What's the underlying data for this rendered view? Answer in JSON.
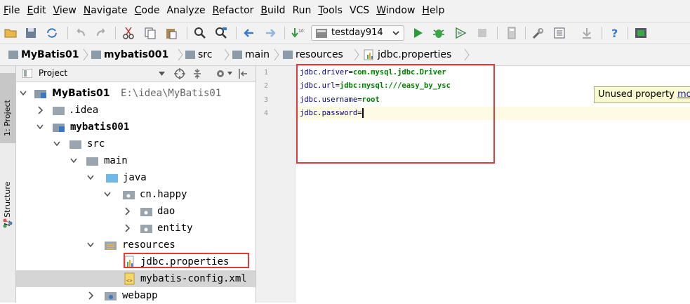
{
  "menu": [
    {
      "mnemonic": "F",
      "rest": "ile"
    },
    {
      "mnemonic": "E",
      "rest": "dit"
    },
    {
      "mnemonic": "V",
      "rest": "iew"
    },
    {
      "mnemonic": "N",
      "rest": "avigate"
    },
    {
      "mnemonic": "C",
      "rest": "ode"
    },
    {
      "mnemonic": "",
      "rest": "Analyze"
    },
    {
      "mnemonic": "R",
      "rest": "efactor"
    },
    {
      "mnemonic": "B",
      "rest": "uild"
    },
    {
      "mnemonic": "",
      "rest": "Run"
    },
    {
      "mnemonic": "T",
      "rest": "ools"
    },
    {
      "mnemonic": "",
      "rest": "VCS"
    },
    {
      "mnemonic": "W",
      "rest": "indow"
    },
    {
      "mnemonic": "H",
      "rest": "elp"
    }
  ],
  "toolbar": {
    "run_config": "testday914"
  },
  "breadcrumb": [
    "MyBatis01",
    "mybatis001",
    "src",
    "main",
    "resources",
    "jdbc.properties"
  ],
  "left_strip": {
    "project_tab": "1: Project",
    "structure_tab": "7: Structure"
  },
  "project_panel": {
    "title": "Project"
  },
  "tree": [
    {
      "label": "MyBatis01",
      "path": "E:\\idea\\MyBatis01"
    },
    {
      "label": ".idea"
    },
    {
      "label": "mybatis001"
    },
    {
      "label": "src"
    },
    {
      "label": "main"
    },
    {
      "label": "java"
    },
    {
      "label": "cn.happy"
    },
    {
      "label": "dao"
    },
    {
      "label": "entity"
    },
    {
      "label": "resources"
    },
    {
      "label": "jdbc.properties"
    },
    {
      "label": "mybatis-config.xml"
    },
    {
      "label": "webapp"
    }
  ],
  "editor": {
    "line_numbers": [
      "1",
      "2",
      "3",
      "4"
    ],
    "lines": [
      {
        "key": "jdbc.driver",
        "sep": "=",
        "value": "com.mysql.jdbc.Driver"
      },
      {
        "key": "jdbc.url",
        "sep": "=",
        "value": "jdbc:mysql:///easy_by_ysc"
      },
      {
        "key": "jdbc.username",
        "sep": "=",
        "value": "root"
      },
      {
        "key": "jdbc.password",
        "sep": "=",
        "value": ""
      }
    ]
  },
  "tooltip": {
    "text": "Unused property ",
    "link": "mo"
  },
  "colors": {
    "highlight_box": "#e03a3a",
    "property_value": "#008000",
    "property_key": "#000080"
  }
}
